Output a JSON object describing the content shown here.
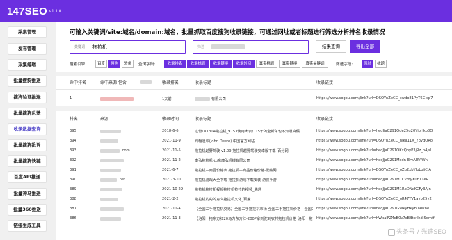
{
  "app": {
    "title": "147SEO",
    "version": "v1.1.0"
  },
  "sidebar": {
    "items": [
      {
        "label": "采集管理"
      },
      {
        "label": "发布管理"
      },
      {
        "label": "采集编辑"
      },
      {
        "label": "批量搜狗推送"
      },
      {
        "label": "搜狗验证推送"
      },
      {
        "label": "批量搜狗反馈"
      },
      {
        "label": "收录数据查询",
        "active": true
      },
      {
        "label": "批量搜狗投诉"
      },
      {
        "label": "批量搜狗快链"
      },
      {
        "label": "百度API推送"
      },
      {
        "label": "批量神马推送"
      },
      {
        "label": "批量360推送"
      },
      {
        "label": "链接生成工具"
      }
    ]
  },
  "main": {
    "headline": "可输入关键词/site:域名/domain:域名，批量抓取百度搜狗收录链接，可通过网址或者标题进行筛选分析排名收录情况",
    "keyword_input": {
      "label": "关键词",
      "value": "拖拉机"
    },
    "filter_input": {
      "placeholder": "筛选"
    },
    "export_query_label": "结果查询",
    "export_all_label": "导出全部",
    "engine_label": "搜索引擎:",
    "engines": [
      "百度",
      "搜狗",
      "头条"
    ],
    "query_field_label": "查询字段:",
    "query_fields": [
      "收录排名",
      "收录标题",
      "收录链接",
      "收录时间",
      "真实标题",
      "真实链接",
      "真实关键词"
    ],
    "filter_field_label": "筛选字段:",
    "filter_fields": [
      "网址",
      "标题"
    ],
    "summary_headers": {
      "hit_rank": "命中排名",
      "hit_source": "命中来源 包含",
      "ranking": "收录排名",
      "title": "收录标题",
      "link": "收录链接"
    },
    "summary_row": {
      "hit_rank": "1",
      "ranking": "1天前",
      "title": "有限公司",
      "link": "https://www.sogou.com/link?url=DSOYnZeCC_cwdo81PyT6C-sp7"
    },
    "table_headers": {
      "rank": "排名",
      "source": "来源",
      "time": "收录时间",
      "title": "收录标题",
      "link": "收录链接"
    },
    "rows": [
      {
        "rank": "395",
        "source": "",
        "time": "2018-6-6",
        "title": "这份LX1304拖拉机_9753使用大表！15年的全新车也不知道真假",
        "link": "https://www.sogou.com/link?url=hedJjaC291Ode25g20YjoHko8O"
      },
      {
        "rank": "394",
        "source": "",
        "time": "2021-11-9",
        "title": "约翰迪尔(John Deere) 中国官方网站",
        "link": "https://www.sogou.com/link?url=DSOYnZeCC_nika11X_YbydQRo"
      },
      {
        "rank": "393",
        "source": ".com",
        "time": "2021-11-5",
        "title": "拖拉机越野驾驶 v1.09 拖拉机越野驾驶安卓版下载_百分网",
        "link": "https://www.sogou.com/link?url=hedJjaC291OKxQoyP3jRz_p4jsl"
      },
      {
        "rank": "392",
        "source": "",
        "time": "2021-11-2",
        "title": "康弘拖拉机-山东康弘机械有限公司",
        "link": "https://www.sogou.com/link?url=hedJjaC291Msdn-ErvARVfWn"
      },
      {
        "rank": "391",
        "source": "",
        "time": "2021-6-7",
        "title": "拖拉机—商品价格表 拖拉机—商品价格价格-爱藏网",
        "link": "https://www.sogou.com/link?url=DSOYnZeCC_oZg2xbYJoLojiCiA"
      },
      {
        "rank": "390",
        "source": ".net",
        "time": "2021-3-10",
        "title": "拖拉机游戏大全下载-拖拉机游戏下载安装-游侠手游",
        "link": "https://www.sogou.com/link?url=hedJjaC291M1CvmyX0b11eR"
      },
      {
        "rank": "389",
        "source": "",
        "time": "2021-10-29",
        "title": "拖拉机拖拉机视频拖拉机拉拉的视频_腾通",
        "link": "https://www.sogou.com/link?url=hedJjaC291M1RbDNxKCFy3AJn"
      },
      {
        "rank": "388",
        "source": "",
        "time": "2021-2-2",
        "title": "拖拉机的的的意义拖拉机文化_百度",
        "link": "https://www.sogou.com/link?url=DSOYnZeCC_oR47YV1ayb25y2"
      },
      {
        "rank": "387",
        "source": "",
        "time": "2021-11-4",
        "title": "【全国二手拖拉机交易】全国二手拖拉机市场-全国二手拖拉机价格 - 全国二",
        "link": "https://www.sogou.com/link?url=hedJjaC291GWPyHPyb09W8e"
      },
      {
        "rank": "386",
        "source": "",
        "time": "2021-11-3",
        "title": "【洛阳一拖东方红20马力东方红-200P拿到驼到农村拖拉机价格_洛阳一拖东方",
        "link": "https://www.sogou.com/link?url=hWxalFZ4cB0v7sBBtb4hd.Sdmff"
      }
    ]
  },
  "watermark": "头条号 / 光速SEO"
}
